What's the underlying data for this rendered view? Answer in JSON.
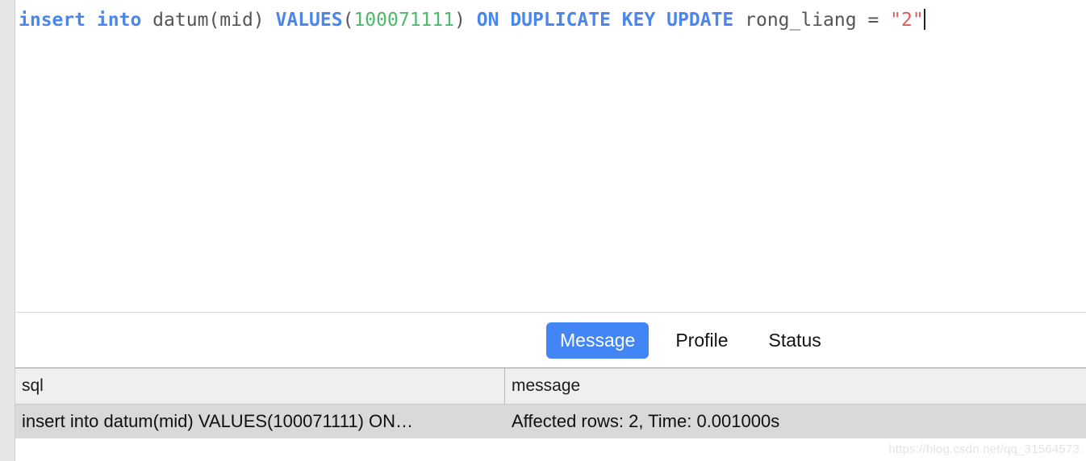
{
  "editor": {
    "query_tokens": [
      {
        "text": "insert into",
        "type": "keyword"
      },
      {
        "text": " datum(mid) ",
        "type": "plain"
      },
      {
        "text": "VALUES",
        "type": "keyword"
      },
      {
        "text": "(",
        "type": "plain"
      },
      {
        "text": "100071111",
        "type": "number"
      },
      {
        "text": ") ",
        "type": "plain"
      },
      {
        "text": "ON DUPLICATE KEY UPDATE",
        "type": "keyword"
      },
      {
        "text": " rong_liang = ",
        "type": "plain"
      },
      {
        "text": "\"2\"",
        "type": "string"
      }
    ],
    "kw1": "insert into",
    "plain1": " datum(mid) ",
    "kw2": "VALUES",
    "plain2": "(",
    "num1": "100071111",
    "plain3": ") ",
    "kw3": "ON DUPLICATE KEY UPDATE",
    "plain4": " rong_liang = ",
    "str1": "\"2\"",
    "full_query": "insert into datum(mid) VALUES(100071111) ON DUPLICATE KEY UPDATE rong_liang = \"2\"",
    "cursor_visible": true,
    "colors": {
      "keyword": "#4a86ec",
      "number": "#4cb96b",
      "string": "#dc5c59",
      "plain": "#555555"
    }
  },
  "tabs": {
    "items": [
      {
        "label": "Message",
        "active": true
      },
      {
        "label": "Profile",
        "active": false
      },
      {
        "label": "Status",
        "active": false
      }
    ],
    "message_label": "Message",
    "profile_label": "Profile",
    "status_label": "Status",
    "active_color": "#4285f4"
  },
  "results_table": {
    "columns": [
      "sql",
      "message"
    ],
    "col_sql": "sql",
    "col_message": "message",
    "rows": [
      {
        "sql": "insert into datum(mid) VALUES(100071111) ON…",
        "message": "Affected rows: 2, Time: 0.001000s"
      }
    ],
    "row0_sql": "insert into datum(mid) VALUES(100071111) ON…",
    "row0_message": "Affected rows: 2, Time: 0.001000s",
    "header_bg": "#efefef",
    "row_bg": "#d9d9d9"
  },
  "watermark": {
    "text": "https://blog.csdn.net/qq_31564573"
  }
}
